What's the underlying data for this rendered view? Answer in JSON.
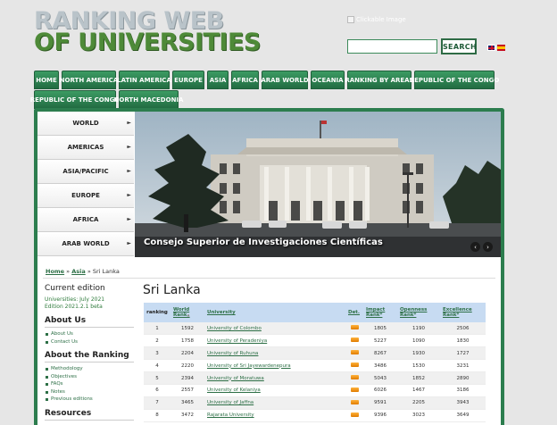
{
  "header": {
    "logo_line1": "RANKING WEB",
    "logo_line2": "OF UNIVERSITIES",
    "broken_image_alt": "Clickable Image",
    "search_placeholder": "",
    "search_button": "SEARCH"
  },
  "nav": {
    "tabs": [
      "HOME",
      "NORTH AMERICA",
      "LATIN AMERICA",
      "EUROPE",
      "ASIA",
      "AFRICA",
      "ARAB WORLD",
      "OCEANIA",
      "RANKING BY AREAS",
      "REPUBLIC OF THE CONGO",
      "REPUBLIC OF THE CONGO",
      "NORTH MACEDONIA"
    ]
  },
  "side_menu": {
    "items": [
      "WORLD",
      "AMERICAS",
      "ASIA/PACIFIC",
      "EUROPE",
      "AFRICA",
      "ARAB WORLD"
    ]
  },
  "hero": {
    "caption": "Consejo Superior de Investigaciones Científicas",
    "prev": "‹",
    "next": "›"
  },
  "breadcrumb": {
    "home": "Home",
    "asia": "Asia",
    "sep": "»",
    "current": "Sri Lanka"
  },
  "info": {
    "current_edition_title": "Current edition",
    "edition_line1": "Universities: July 2021",
    "edition_line2": "Edition 2021.2.1 beta",
    "about_us_title": "About Us",
    "about_us_links": [
      "About Us",
      "Contact Us"
    ],
    "about_ranking_title": "About the Ranking",
    "about_ranking_links": [
      "Methodology",
      "Objectives",
      "FAQs",
      "Notes",
      "Previous editions"
    ],
    "resources_title": "Resources"
  },
  "main": {
    "title": "Sri Lanka",
    "columns": {
      "ranking": "ranking",
      "world_rank_1": "World",
      "world_rank_2": "Rank",
      "sort_indicator": "▲",
      "university": "University",
      "det": "Det.",
      "impact_1": "Impact",
      "impact_2": "Rank*",
      "openness_1": "Openness",
      "openness_2": "Rank*",
      "excellence_1": "Excellence",
      "excellence_2": "Rank*"
    },
    "rows": [
      {
        "ranking": "1",
        "world": "1592",
        "university": "University of Colombo",
        "impact": "1805",
        "openness": "1190",
        "excellence": "2506"
      },
      {
        "ranking": "2",
        "world": "1758",
        "university": "University of Peradeniya",
        "impact": "5227",
        "openness": "1090",
        "excellence": "1830"
      },
      {
        "ranking": "3",
        "world": "2204",
        "university": "University of Ruhuna",
        "impact": "8267",
        "openness": "1930",
        "excellence": "1727"
      },
      {
        "ranking": "4",
        "world": "2220",
        "university": "University of Sri Jayewardenepura",
        "impact": "3486",
        "openness": "1530",
        "excellence": "3231"
      },
      {
        "ranking": "5",
        "world": "2394",
        "university": "University of Moratuwa",
        "impact": "5043",
        "openness": "1852",
        "excellence": "2890"
      },
      {
        "ranking": "6",
        "world": "2557",
        "university": "University of Kelaniya",
        "impact": "6026",
        "openness": "1467",
        "excellence": "3186"
      },
      {
        "ranking": "7",
        "world": "3465",
        "university": "University of Jaffna",
        "impact": "9591",
        "openness": "2205",
        "excellence": "3943"
      },
      {
        "ranking": "8",
        "world": "3472",
        "university": "Rajarata University",
        "impact": "9396",
        "openness": "3023",
        "excellence": "3649"
      }
    ]
  }
}
